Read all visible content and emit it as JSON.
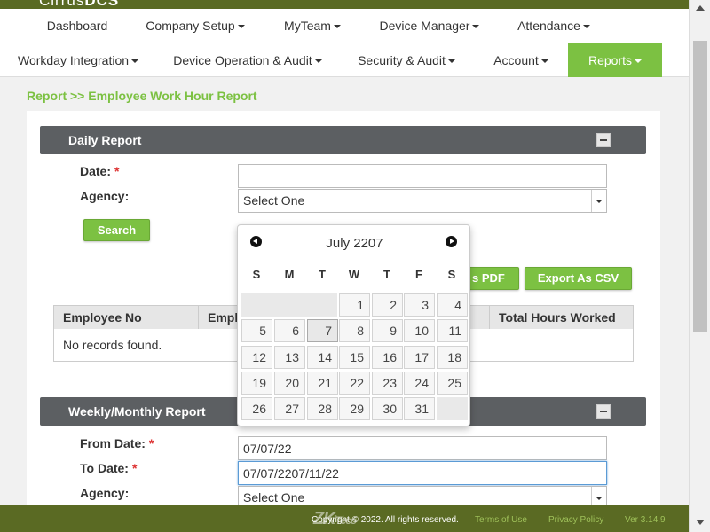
{
  "app": {
    "logo_text_a": "Cirrus",
    "logo_text_b": "DCS"
  },
  "nav": {
    "row1": [
      {
        "label": "Dashboard",
        "has_caret": false
      },
      {
        "label": "Company Setup",
        "has_caret": true
      },
      {
        "label": "MyTeam",
        "has_caret": true
      },
      {
        "label": "Device Manager",
        "has_caret": true
      },
      {
        "label": "Attendance",
        "has_caret": true
      }
    ],
    "row2": [
      {
        "label": "Workday Integration",
        "has_caret": true
      },
      {
        "label": "Device Operation & Audit",
        "has_caret": true
      },
      {
        "label": "Security & Audit",
        "has_caret": true
      },
      {
        "label": "Account",
        "has_caret": true
      },
      {
        "label": "Reports",
        "has_caret": true,
        "active": true
      }
    ]
  },
  "breadcrumb": "Report >> Employee Work Hour Report",
  "daily": {
    "title": "Daily Report",
    "date_label": "Date:",
    "required_mark": "*",
    "date_value": "",
    "agency_label": "Agency:",
    "agency_value": "Select One",
    "search_button": "Search",
    "export_pdf_button": "Export As PDF",
    "export_pdf_visible_fragment": "s PDF",
    "export_csv_button": "Export As CSV",
    "table": {
      "columns": [
        "Employee No",
        "Employee Name",
        "Total Hours Worked"
      ],
      "visible_column_fragment": "Emplo",
      "empty_message": "No records found."
    }
  },
  "weekly": {
    "title": "Weekly/Monthly Report",
    "from_label": "From Date:",
    "from_value": "07/07/22",
    "to_label": "To Date:",
    "to_value": "07/07/2207/11/22",
    "agency_label": "Agency:",
    "agency_value": "Select One",
    "required_mark": "*"
  },
  "datepicker": {
    "month_label": "July 2207",
    "weekdays": [
      "S",
      "M",
      "T",
      "W",
      "T",
      "F",
      "S"
    ],
    "leading_empty": 3,
    "days": [
      "1",
      "2",
      "3",
      "4",
      "5",
      "6",
      "7",
      "8",
      "9",
      "10",
      "11",
      "12",
      "13",
      "14",
      "15",
      "16",
      "17",
      "18",
      "19",
      "20",
      "21",
      "22",
      "23",
      "24",
      "25",
      "26",
      "27",
      "28",
      "29",
      "30",
      "31"
    ],
    "highlighted_day": "7"
  },
  "footer": {
    "copyright": "Copyright © 2022. All rights reserved.",
    "terms": "Terms of Use",
    "privacy": "Privacy Policy",
    "version": "Ver 3.14.9",
    "brand_a": "ZK",
    "brand_b": "Teco"
  },
  "colors": {
    "accent_green": "#7cc142",
    "header_olive": "#5a6a23",
    "section_gray": "#5c5f62"
  }
}
